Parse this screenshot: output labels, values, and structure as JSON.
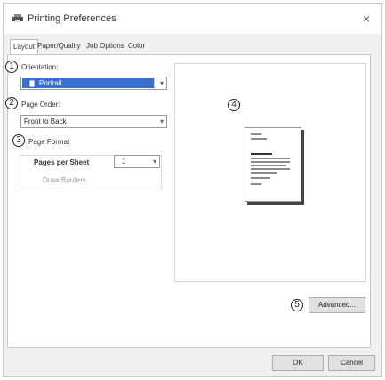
{
  "window": {
    "title": "Printing Preferences",
    "close_glyph": "×"
  },
  "tabs": [
    {
      "label": "Layout",
      "active": true
    },
    {
      "label": "Paper/Quality",
      "active": false
    },
    {
      "label": "Job Options",
      "active": false
    },
    {
      "label": "Color",
      "active": false
    }
  ],
  "callouts": [
    "1",
    "2",
    "3",
    "4",
    "5"
  ],
  "orientation": {
    "label": "Orientation:",
    "value": "Portrait"
  },
  "page_order": {
    "label": "Page Order:",
    "value": "Front to Back"
  },
  "page_format": {
    "label": "Page Format",
    "pages_per_sheet_label": "Pages per Sheet",
    "pages_per_sheet_value": "1",
    "draw_borders_label": "Draw Borders"
  },
  "buttons": {
    "advanced": "Advanced...",
    "ok": "OK",
    "cancel": "Cancel"
  },
  "icons": {
    "printer": "printer-icon",
    "dropdown": "chevron-down-icon",
    "close": "close-icon"
  },
  "colors": {
    "selection": "#3a6fd0",
    "window_bg": "#f0f0f0"
  }
}
